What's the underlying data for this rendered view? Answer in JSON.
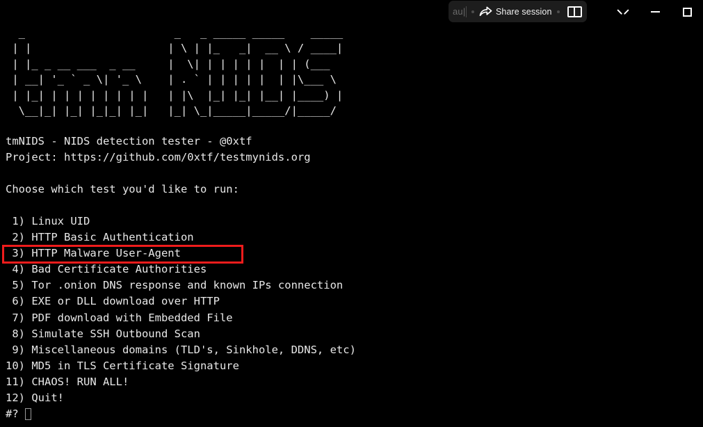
{
  "window": {
    "background_color": "#000000",
    "text_color": "#ededed",
    "controls": {
      "chevron_label": "chevron-down",
      "minimize_label": "minimize",
      "maximize_label": "maximize"
    }
  },
  "toolbar": {
    "clipped_label": "au|",
    "share_label": "Share session",
    "share_icon": "share-arrow-icon",
    "split_icon": "split-pane-icon",
    "background_color": "#1d1d1d"
  },
  "terminal": {
    "banner": "  _                       _   _ _____ _____    _____\n | |                     | \\ | |_   _|  __ \\ / ____|\n | |_ _ __ ___  _ __     |  \\| | | | | |  | | (___\n | __| '_ ` _ \\| '_ \\    | . ` | | | | |  | |\\___ \\\n | |_| | | | | | | | |   | |\\  |_| |_| |__| |____) |\n  \\__|_| |_| |_|_| |_|   |_| \\_|_____|_____/|_____/",
    "title_line": "tmNIDS - NIDS detection tester - @0xtf",
    "project_line": "Project: https://github.com/0xtf/testmynids.org",
    "prompt_question": "Choose which test you'd like to run:",
    "menu_items": [
      " 1) Linux UID",
      " 2) HTTP Basic Authentication",
      " 3) HTTP Malware User-Agent",
      " 4) Bad Certificate Authorities",
      " 5) Tor .onion DNS response and known IPs connection",
      " 6) EXE or DLL download over HTTP",
      " 7) PDF download with Embedded File",
      " 8) Simulate SSH Outbound Scan",
      " 9) Miscellaneous domains (TLD's, Sinkhole, DDNS, etc)",
      "10) MD5 in TLS Certificate Signature",
      "11) CHAOS! RUN ALL!",
      "12) Quit!"
    ],
    "command_prompt": "#?",
    "cursor": "block-cursor"
  },
  "annotation": {
    "highlight_color": "#ef1c1c",
    "highlight_target": " 3) HTTP Malware User-Agent"
  }
}
